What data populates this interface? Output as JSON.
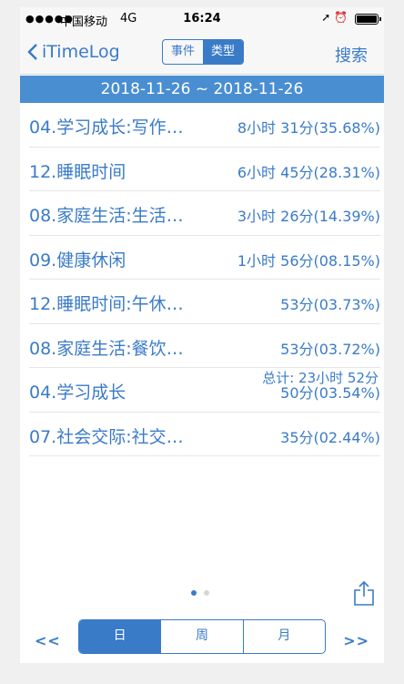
{
  "status_bar": {
    "carrier": "中国移动",
    "network": "4G",
    "time": "16:24",
    "indicators": "➚ ⏰"
  },
  "nav": {
    "back_label": "iTimeLog",
    "segments": [
      "事件",
      "类型"
    ],
    "active_segment": 1,
    "search_label": "搜索"
  },
  "date_range": "2018-11-26 ~ 2018-11-26",
  "items": [
    {
      "name": "04.学习成长:写作…",
      "duration": "8小时 31分(35.68%)"
    },
    {
      "name": "12.睡眠时间",
      "duration": "6小时 45分(28.31%)"
    },
    {
      "name": "08.家庭生活:生活…",
      "duration": "3小时 26分(14.39%)"
    },
    {
      "name": "09.健康休闲",
      "duration": "1小时 56分(08.15%)"
    },
    {
      "name": "12.睡眠时间:午休…",
      "duration": "53分(03.73%)"
    },
    {
      "name": "08.家庭生活:餐饮…",
      "duration": "53分(03.72%)"
    },
    {
      "name": "04.学习成长",
      "duration": "50分(03.54%)"
    },
    {
      "name": "07.社会交际:社交…",
      "duration": "35分(02.44%)"
    }
  ],
  "total": "总计: 23小时 52分",
  "page_dots": 2,
  "bottom": {
    "prev_label": "<<",
    "next_label": ">>",
    "periods": [
      "日",
      "周",
      "月"
    ],
    "active_period": 0
  },
  "colors": {
    "accent": "#3a7bc8",
    "date_bar": "#4a8ed2"
  }
}
